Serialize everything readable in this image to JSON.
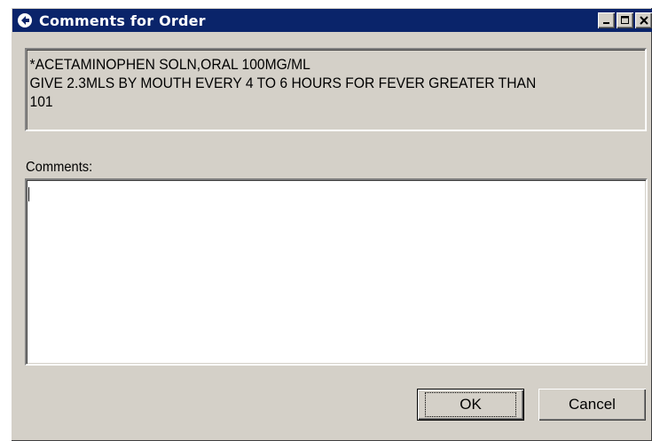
{
  "window": {
    "title": "Comments for Order",
    "icon": "app-icon",
    "controls": [
      "minimize-icon",
      "maximize-icon",
      "close-icon"
    ]
  },
  "order": {
    "lines": [
      "*ACETAMINOPHEN SOLN,ORAL  100MG/ML",
      "GIVE 2.3MLS BY MOUTH EVERY 4 TO 6 HOURS FOR FEVER GREATER THAN",
      "101"
    ]
  },
  "comments": {
    "label": "Comments:",
    "value": ""
  },
  "buttons": {
    "ok_label": "OK",
    "cancel_label": "Cancel"
  },
  "colors": {
    "titlebar": "#0a246a",
    "face": "#d4d0c8"
  }
}
